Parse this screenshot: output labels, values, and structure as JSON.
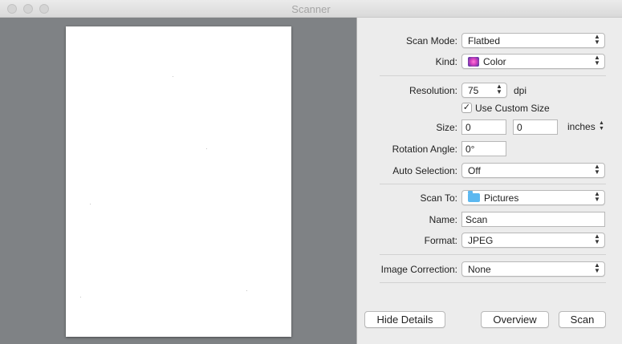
{
  "window": {
    "title": "Scanner"
  },
  "details": {
    "scan_mode": {
      "label": "Scan Mode:",
      "value": "Flatbed"
    },
    "kind": {
      "label": "Kind:",
      "value": "Color",
      "icon": "color-swatch-icon"
    },
    "resolution": {
      "label": "Resolution:",
      "value": "75",
      "unit": "dpi"
    },
    "custom_size": {
      "label": "Use Custom Size",
      "checked": true,
      "mark": "✓"
    },
    "size": {
      "label": "Size:",
      "width": "0",
      "height": "0",
      "unit": "inches"
    },
    "rotation": {
      "label": "Rotation Angle:",
      "value": "0°"
    },
    "auto_selection": {
      "label": "Auto Selection:",
      "value": "Off"
    },
    "scan_to": {
      "label": "Scan To:",
      "value": "Pictures",
      "icon": "folder-icon"
    },
    "name": {
      "label": "Name:",
      "value": "Scan"
    },
    "format": {
      "label": "Format:",
      "value": "JPEG"
    },
    "image_correction": {
      "label": "Image Correction:",
      "value": "None"
    }
  },
  "buttons": {
    "hide_details": "Hide Details",
    "overview": "Overview",
    "scan": "Scan"
  },
  "glyphs": {
    "up": "▲",
    "down": "▼"
  }
}
